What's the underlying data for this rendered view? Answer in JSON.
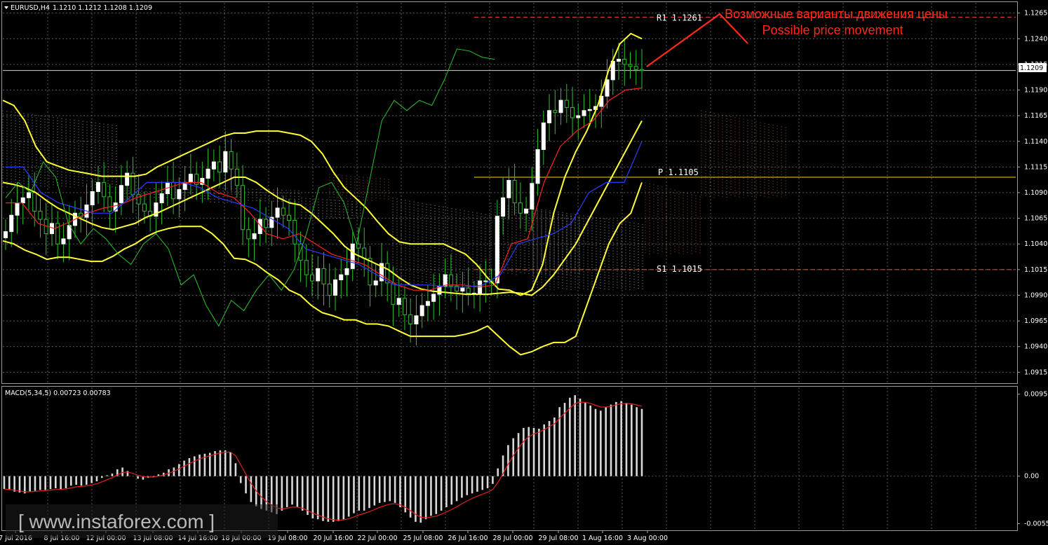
{
  "header": {
    "symbol_label": "EURUSD,H4",
    "ohlc": "1.1210 1.1212 1.1208 1.1209"
  },
  "annotation": {
    "line1": "Возможные варианты движения цены",
    "line2": "Possible price movement"
  },
  "macd": {
    "label": "MACD(5,34,5) 0.00723 0.00783"
  },
  "watermark": "[ www.instaforex.com ]",
  "colors": {
    "background": "#000000",
    "grid": "#5a5a5a",
    "bollinger": "#ffff33",
    "tenkan": "#ff2020",
    "kijun": "#2a3cff",
    "chikou": "#2fbf2f",
    "cloud_a": "#bfbfbf",
    "cloud_b": "#c86e3c",
    "annotation": "#ff2a1a",
    "pivot": "#ffd700",
    "macd_bars": "#d8d8d8",
    "macd_signal": "#e02020"
  },
  "chart_data": [
    {
      "type": "candlestick",
      "title": "EURUSD,H4",
      "ylim": [
        1.0905,
        1.1275
      ],
      "price_ticks": [
        "1.1265",
        "1.1240",
        "1.1215",
        "1.1190",
        "1.1165",
        "1.1140",
        "1.1115",
        "1.1090",
        "1.1065",
        "1.1040",
        "1.1015",
        "1.0990",
        "1.0965",
        "1.0940",
        "1.0915"
      ],
      "current_price": "1.1209",
      "time_labels": [
        "7 Jul 2016",
        "8 Jul 16:00",
        "12 Jul 00:00",
        "13 Jul 08:00",
        "14 Jul 16:00",
        "18 Jul 00:00",
        "19 Jul 08:00",
        "20 Jul 16:00",
        "22 Jul 00:00",
        "25 Jul 08:00",
        "26 Jul 16:00",
        "28 Jul 00:00",
        "29 Jul 08:00",
        "1 Aug 16:00",
        "3 Aug 00:00"
      ],
      "close": [
        1.1052,
        1.1068,
        1.108,
        1.1085,
        1.109,
        1.1072,
        1.1064,
        1.105,
        1.106,
        1.104,
        1.1045,
        1.1058,
        1.107,
        1.1066,
        1.1078,
        1.1091,
        1.11,
        1.1086,
        1.1072,
        1.108,
        1.1097,
        1.1109,
        1.1088,
        1.1079,
        1.1072,
        1.1067,
        1.108,
        1.1089,
        1.11,
        1.1084,
        1.1093,
        1.11,
        1.1108,
        1.1098,
        1.1104,
        1.1113,
        1.112,
        1.111,
        1.113,
        1.1113,
        1.1097,
        1.1054,
        1.1045,
        1.105,
        1.1064,
        1.1056,
        1.1066,
        1.1075,
        1.1068,
        1.1063,
        1.104,
        1.1024,
        1.101,
        1.1004,
        1.1016,
        1.1001,
        1.099,
        1.1005,
        1.101,
        1.1016,
        1.104,
        1.1036,
        1.1026,
        1.1,
        1.1004,
        1.1021,
        1.1002,
        1.0981,
        1.0987,
        1.0971,
        1.0962,
        1.097,
        1.098,
        1.0984,
        1.0991,
        1.0999,
        1.101,
        1.0999,
        1.0994,
        1.0997,
        1.0992,
        1.0992,
        1.1004,
        1.1004,
        1.1002,
        1.1067,
        1.1085,
        1.1102,
        1.108,
        1.107,
        1.1074,
        1.1099,
        1.1132,
        1.1158,
        1.117,
        1.1168,
        1.118,
        1.1173,
        1.1163,
        1.1165,
        1.117,
        1.1171,
        1.1174,
        1.1184,
        1.12,
        1.1218,
        1.122,
        1.1215,
        1.1213,
        1.121,
        1.1209
      ],
      "bollinger_upper": [
        1.118,
        1.1175,
        1.116,
        1.1135,
        1.112,
        1.1116,
        1.1112,
        1.111,
        1.1108,
        1.1106,
        1.1106,
        1.1106,
        1.1106,
        1.1108,
        1.1115,
        1.112,
        1.1125,
        1.113,
        1.1135,
        1.114,
        1.1145,
        1.1148,
        1.1148,
        1.115,
        1.115,
        1.115,
        1.1148,
        1.1146,
        1.114,
        1.1128,
        1.111,
        1.1095,
        1.1085,
        1.1075,
        1.1062,
        1.105,
        1.1042,
        1.104,
        1.104,
        1.104,
        1.104,
        1.1035,
        1.103,
        1.102,
        1.1007,
        1.0996,
        1.0995,
        1.099,
        1.0995,
        1.102,
        1.107,
        1.1105,
        1.113,
        1.115,
        1.1175,
        1.121,
        1.1235,
        1.1245,
        1.124
      ],
      "bollinger_middle": [
        1.11,
        1.1098,
        1.1095,
        1.109,
        1.1082,
        1.1075,
        1.107,
        1.1065,
        1.106,
        1.1056,
        1.1054,
        1.1057,
        1.106,
        1.1066,
        1.107,
        1.1075,
        1.108,
        1.1085,
        1.109,
        1.1095,
        1.11,
        1.1105,
        1.1105,
        1.11,
        1.1092,
        1.1085,
        1.108,
        1.1078,
        1.107,
        1.106,
        1.105,
        1.1038,
        1.103,
        1.1025,
        1.102,
        1.1015,
        1.1007,
        1.1,
        1.0996,
        1.0994,
        1.0993,
        1.0992,
        1.0991,
        1.0991,
        1.0991,
        1.0992,
        1.0993,
        1.0992,
        1.099,
        1.0998,
        1.101,
        1.1025,
        1.104,
        1.106,
        1.108,
        1.11,
        1.112,
        1.114,
        1.116
      ],
      "bollinger_lower": [
        1.1043,
        1.104,
        1.1034,
        1.103,
        1.1025,
        1.1027,
        1.1027,
        1.1025,
        1.1023,
        1.1023,
        1.1028,
        1.1035,
        1.104,
        1.1047,
        1.1052,
        1.1055,
        1.1057,
        1.1057,
        1.1057,
        1.105,
        1.104,
        1.1026,
        1.1025,
        1.102,
        1.1012,
        1.1005,
        1.0995,
        1.099,
        1.098,
        1.0973,
        1.097,
        1.0966,
        1.0966,
        1.0962,
        1.0962,
        1.096,
        1.0955,
        1.095,
        1.095,
        1.095,
        1.095,
        1.095,
        1.0952,
        1.0955,
        1.096,
        1.095,
        1.094,
        1.0932,
        1.0935,
        1.094,
        1.0944,
        1.0944,
        1.095,
        1.098,
        1.101,
        1.104,
        1.106,
        1.107,
        1.11
      ],
      "levels": [
        {
          "label": "R1",
          "value": "1.1261"
        },
        {
          "label": "P",
          "value": "1.1105"
        },
        {
          "label": "S1",
          "value": "1.1015"
        }
      ]
    },
    {
      "type": "bar",
      "title": "MACD(5,34,5) 0.00723 0.00783",
      "ylim": [
        -0.0062,
        0.0103
      ],
      "y_ticks": [
        "0.00951",
        "0.00",
        "-0.00551"
      ],
      "histogram": [
        -0.0015,
        -0.0016,
        -0.0018,
        -0.0019,
        -0.002,
        -0.0018,
        -0.0017,
        -0.0016,
        -0.0016,
        -0.0015,
        -0.0014,
        -0.0015,
        -0.0014,
        -0.0011,
        -0.001,
        -0.0011,
        -0.001,
        -0.0008,
        -0.0006,
        -0.0002,
        0.0001,
        0.0003,
        0.0008,
        0.001,
        0.0006,
        0.0,
        -0.0003,
        -0.0004,
        -0.0002,
        -0.0001,
        0.0002,
        0.0004,
        0.0008,
        0.001,
        0.0014,
        0.0018,
        0.0021,
        0.0023,
        0.0025,
        0.0026,
        0.0027,
        0.0029,
        0.003,
        0.003,
        0.0028,
        0.0015,
        -0.0008,
        -0.002,
        -0.003,
        -0.0035,
        -0.0038,
        -0.004,
        -0.0042,
        -0.0044,
        -0.004,
        -0.0036,
        -0.0033,
        -0.0036,
        -0.004,
        -0.0045,
        -0.0049,
        -0.005,
        -0.0052,
        -0.0053,
        -0.0053,
        -0.0052,
        -0.005,
        -0.0047,
        -0.0043,
        -0.004,
        -0.004,
        -0.0037,
        -0.0034,
        -0.0031,
        -0.003,
        -0.0029,
        -0.0031,
        -0.0036,
        -0.0042,
        -0.0048,
        -0.0053,
        -0.0054,
        -0.005,
        -0.0046,
        -0.0044,
        -0.004,
        -0.0036,
        -0.0033,
        -0.0029,
        -0.0025,
        -0.0022,
        -0.002,
        -0.0018,
        -0.0016,
        -0.0014,
        -0.0009,
        0.0009,
        0.0024,
        0.0036,
        0.0044,
        0.005,
        0.0056,
        0.0057,
        0.0056,
        0.0055,
        0.006,
        0.0064,
        0.0068,
        0.008,
        0.0085,
        0.0091,
        0.0094,
        0.009,
        0.0085,
        0.0082,
        0.0078,
        0.0076,
        0.008,
        0.0083,
        0.0086,
        0.0087,
        0.0085,
        0.0083,
        0.008,
        0.0078
      ]
    }
  ]
}
